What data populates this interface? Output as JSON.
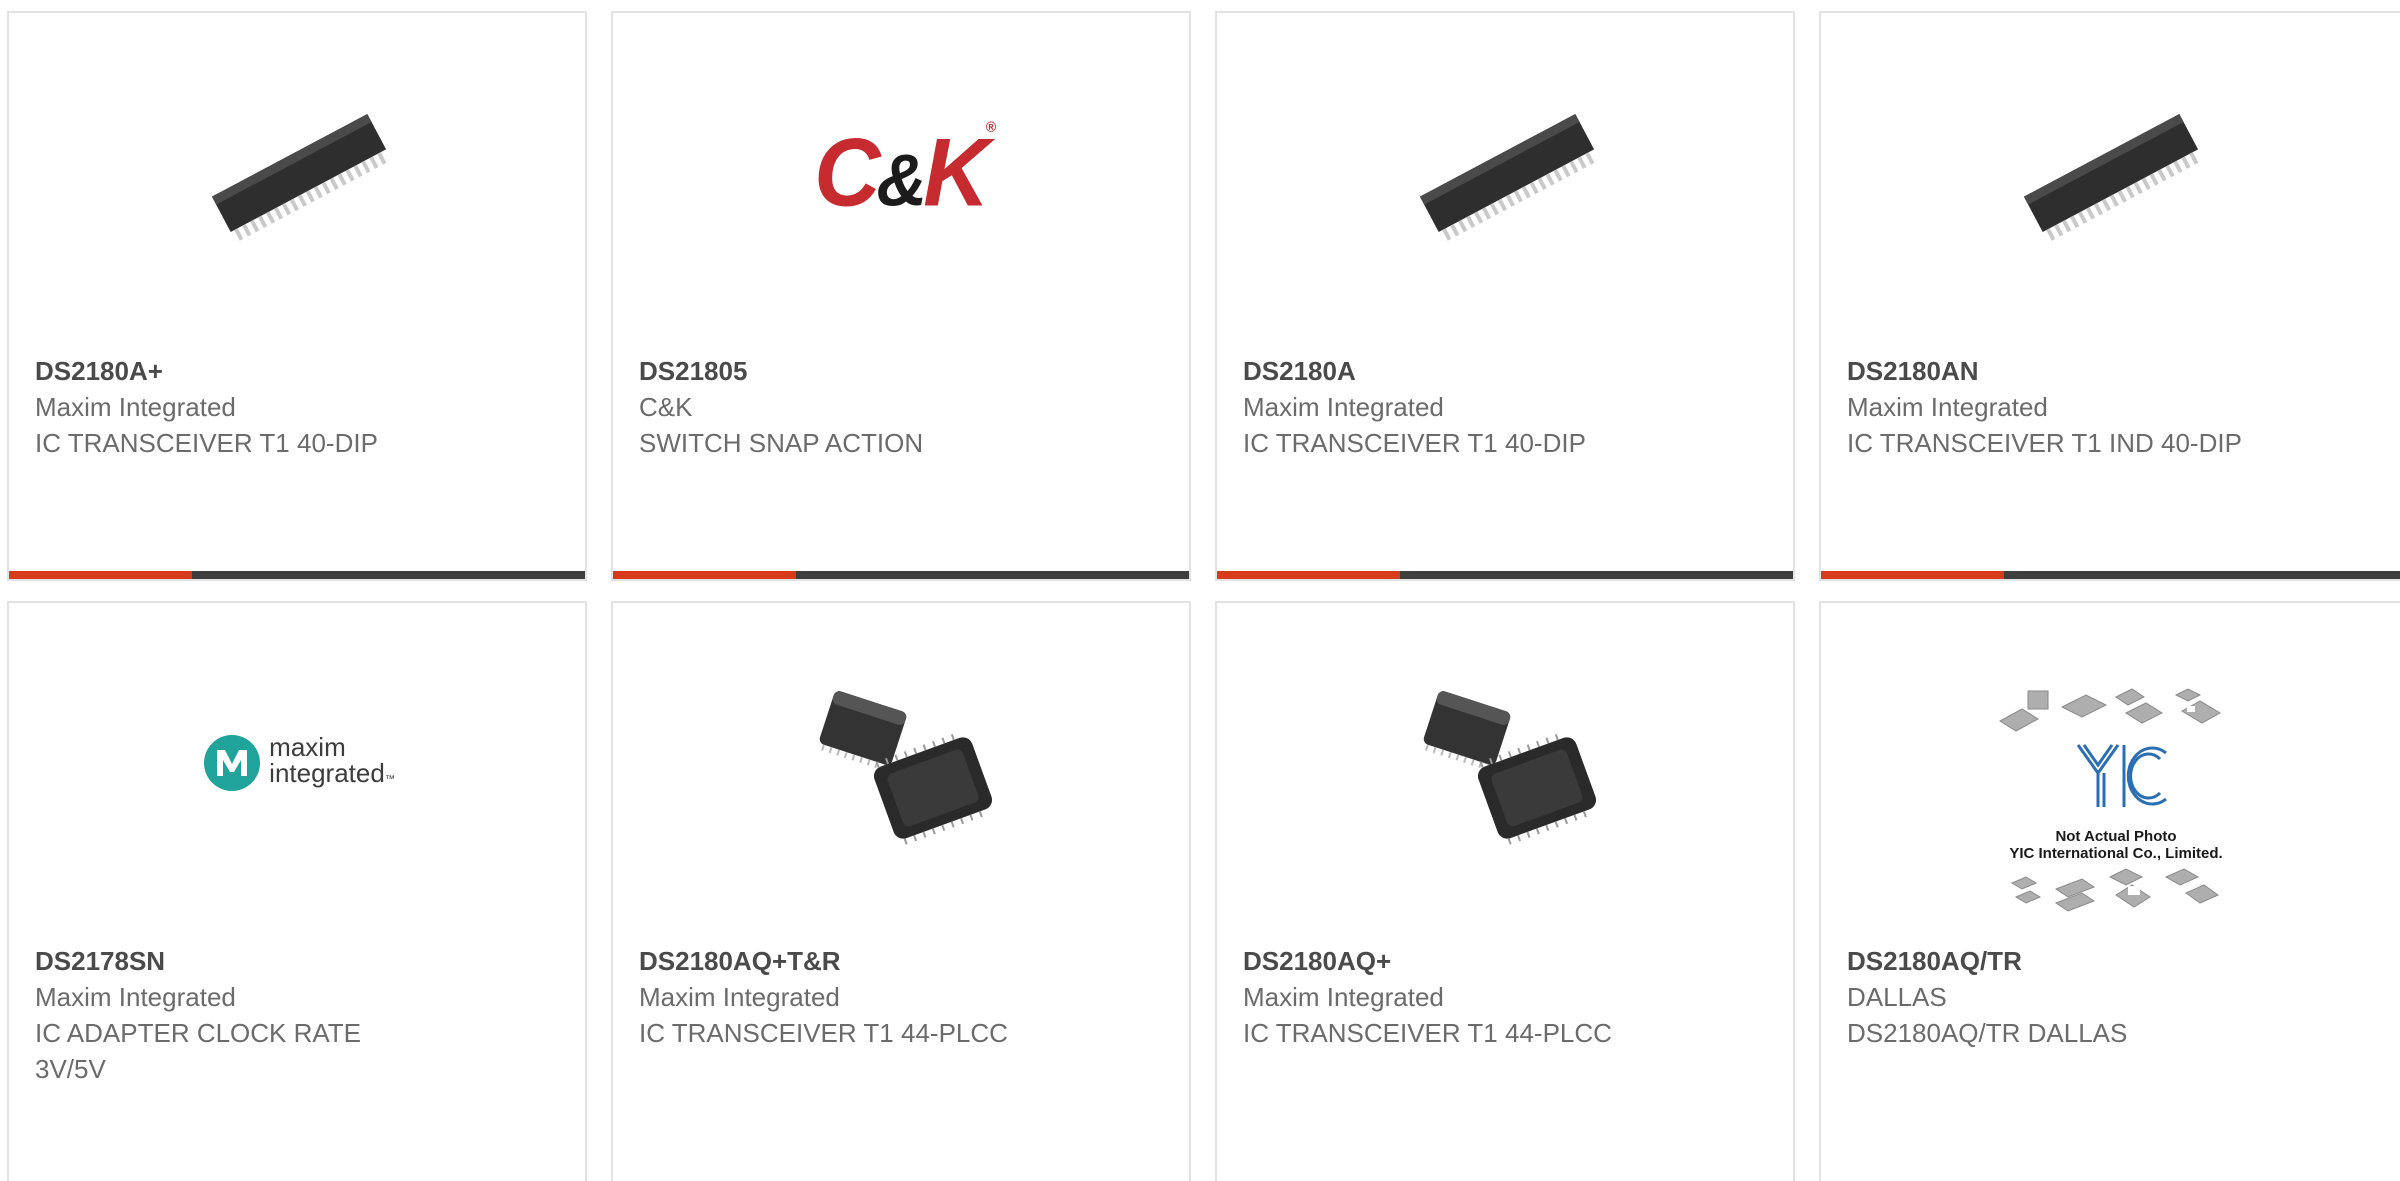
{
  "products": [
    {
      "part_number": "DS2180A+",
      "manufacturer": "Maxim Integrated",
      "description": "IC TRANSCEIVER T1 40-DIP",
      "image": "dip-40-chip-icon"
    },
    {
      "part_number": "DS21805",
      "manufacturer": "C&K",
      "description": "SWITCH SNAP ACTION",
      "image": "ck-logo"
    },
    {
      "part_number": "DS2180A",
      "manufacturer": "Maxim Integrated",
      "description": "IC TRANSCEIVER T1 40-DIP",
      "image": "dip-40-chip-icon"
    },
    {
      "part_number": "DS2180AN",
      "manufacturer": "Maxim Integrated",
      "description": "IC TRANSCEIVER T1 IND 40-DIP",
      "image": "dip-40-chip-icon"
    },
    {
      "part_number": "DS2178SN",
      "manufacturer": "Maxim Integrated",
      "description": "IC ADAPTER CLOCK RATE 3V/5V",
      "image": "maxim-logo"
    },
    {
      "part_number": "DS2180AQ+T&R",
      "manufacturer": "Maxim Integrated",
      "description": "IC TRANSCEIVER T1 44-PLCC",
      "image": "plcc-44-chip-icon"
    },
    {
      "part_number": "DS2180AQ+",
      "manufacturer": "Maxim Integrated",
      "description": "IC TRANSCEIVER T1 44-PLCC",
      "image": "plcc-44-chip-icon"
    },
    {
      "part_number": "DS2180AQ/TR",
      "manufacturer": "DALLAS",
      "description": "DS2180AQ/TR DALLAS",
      "image": "yic-placeholder"
    }
  ],
  "logos": {
    "ck": {
      "c": "C",
      "amp": "&",
      "k": "K",
      "tm": "®"
    },
    "maxim": {
      "line1": "maxim",
      "line2": "integrated",
      "tm": "™"
    },
    "yic": {
      "mark": "YIC",
      "caption1": "Not Actual Photo",
      "caption2": "YIC International Co., Limited."
    }
  },
  "colors": {
    "accent_bar": "#d83a1c",
    "dark_bar": "#3e3e3e",
    "ck_red": "#c62b2f",
    "maxim_teal": "#1fa39a"
  }
}
